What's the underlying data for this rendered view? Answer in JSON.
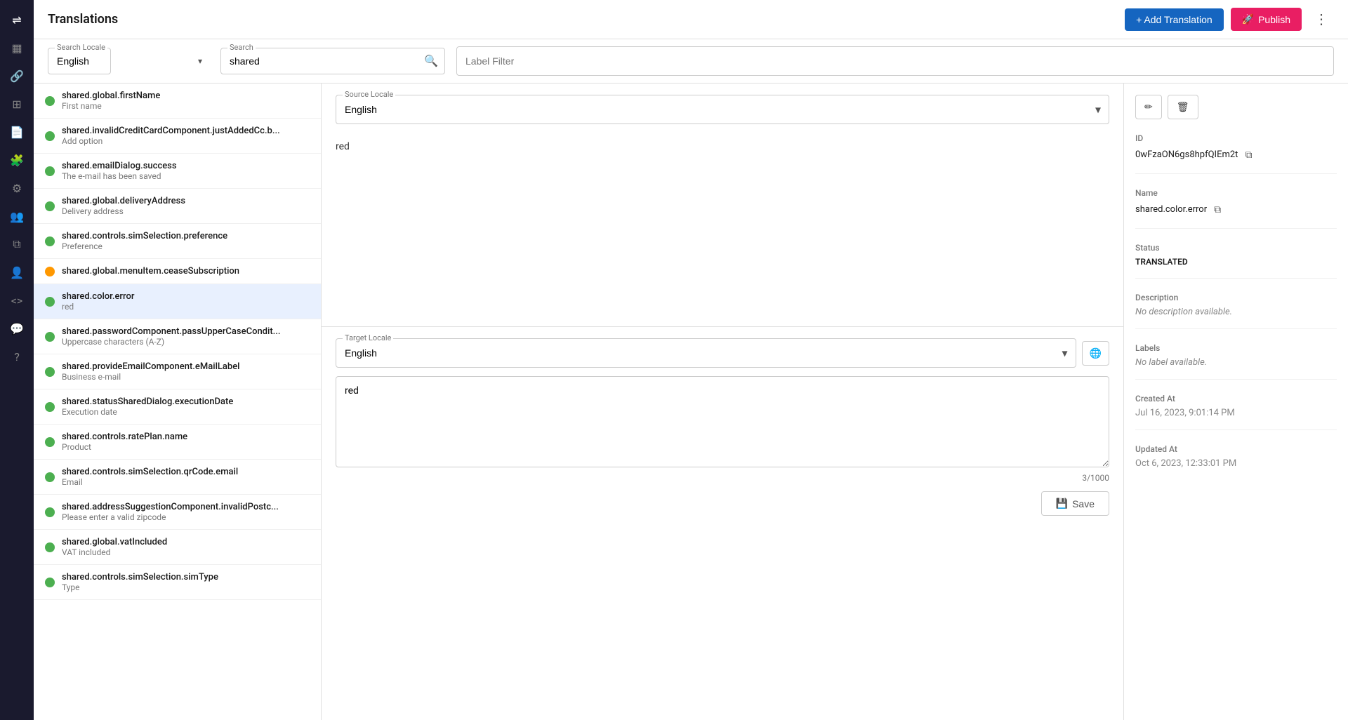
{
  "app": {
    "title": "Translations"
  },
  "header": {
    "add_translation_label": "+ Add Translation",
    "publish_label": "Publish",
    "more_icon": "⋮"
  },
  "filters": {
    "search_locale_label": "Search Locale",
    "search_locale_value": "English",
    "search_label": "Search",
    "search_value": "shared",
    "label_filter_placeholder": "Label Filter"
  },
  "translation_list": {
    "items": [
      {
        "key": "shared.global.firstName",
        "value": "First name",
        "status": "green"
      },
      {
        "key": "shared.invalidCreditCardComponent.justAddedCc.b...",
        "value": "Add option",
        "status": "green"
      },
      {
        "key": "shared.emailDialog.success",
        "value": "The e-mail has been saved",
        "status": "green"
      },
      {
        "key": "shared.global.deliveryAddress",
        "value": "Delivery address",
        "status": "green"
      },
      {
        "key": "shared.controls.simSelection.preference",
        "value": "Preference",
        "status": "green"
      },
      {
        "key": "shared.global.menuItem.ceaseSubscription",
        "value": "",
        "status": "yellow"
      },
      {
        "key": "shared.color.error",
        "value": "red",
        "status": "green",
        "active": true
      },
      {
        "key": "shared.passwordComponent.passUpperCaseCondit...",
        "value": "Uppercase characters (A-Z)",
        "status": "green"
      },
      {
        "key": "shared.provideEmailComponent.eMailLabel",
        "value": "Business e-mail",
        "status": "green"
      },
      {
        "key": "shared.statusSharedDialog.executionDate",
        "value": "Execution date",
        "status": "green"
      },
      {
        "key": "shared.controls.ratePlan.name",
        "value": "Product",
        "status": "green"
      },
      {
        "key": "shared.controls.simSelection.qrCode.email",
        "value": "Email",
        "status": "green"
      },
      {
        "key": "shared.addressSuggestionComponent.invalidPostc...",
        "value": "Please enter a valid zipcode",
        "status": "green"
      },
      {
        "key": "shared.global.vatIncluded",
        "value": "VAT included",
        "status": "green"
      },
      {
        "key": "shared.controls.simSelection.simType",
        "value": "Type",
        "status": "green"
      }
    ]
  },
  "editor": {
    "source_locale_label": "Source Locale",
    "source_locale_value": "English",
    "source_value": "red",
    "target_locale_label": "Target Locale",
    "target_locale_value": "English",
    "target_value": "red",
    "char_count": "3/1000",
    "save_label": "Save"
  },
  "detail": {
    "edit_icon": "✏️",
    "delete_icon": "🗑",
    "id_label": "ID",
    "id_value": "0wFzaON6gs8hpfQIEm2t",
    "name_label": "Name",
    "name_value": "shared.color.error",
    "status_label": "Status",
    "status_value": "TRANSLATED",
    "description_label": "Description",
    "description_value": "No description available.",
    "labels_label": "Labels",
    "labels_value": "No label available.",
    "created_at_label": "Created At",
    "created_at_value": "Jul 16, 2023, 9:01:14 PM",
    "updated_at_label": "Updated At",
    "updated_at_value": "Oct 6, 2023, 12:33:01 PM"
  },
  "sidebar": {
    "icons": [
      {
        "name": "translate-icon",
        "glyph": "⇌"
      },
      {
        "name": "dashboard-icon",
        "glyph": "▦"
      },
      {
        "name": "link-icon",
        "glyph": "🔗"
      },
      {
        "name": "grid-icon",
        "glyph": "⊞"
      },
      {
        "name": "document-icon",
        "glyph": "📄"
      },
      {
        "name": "puzzle-icon",
        "glyph": "🧩"
      },
      {
        "name": "settings-icon",
        "glyph": "⚙"
      },
      {
        "name": "people-icon",
        "glyph": "👥"
      },
      {
        "name": "layers-icon",
        "glyph": "⧉"
      },
      {
        "name": "person-arrow-icon",
        "glyph": "👤"
      },
      {
        "name": "code-icon",
        "glyph": "<>"
      },
      {
        "name": "chat-icon",
        "glyph": "💬"
      },
      {
        "name": "help-icon",
        "glyph": "?"
      }
    ]
  }
}
